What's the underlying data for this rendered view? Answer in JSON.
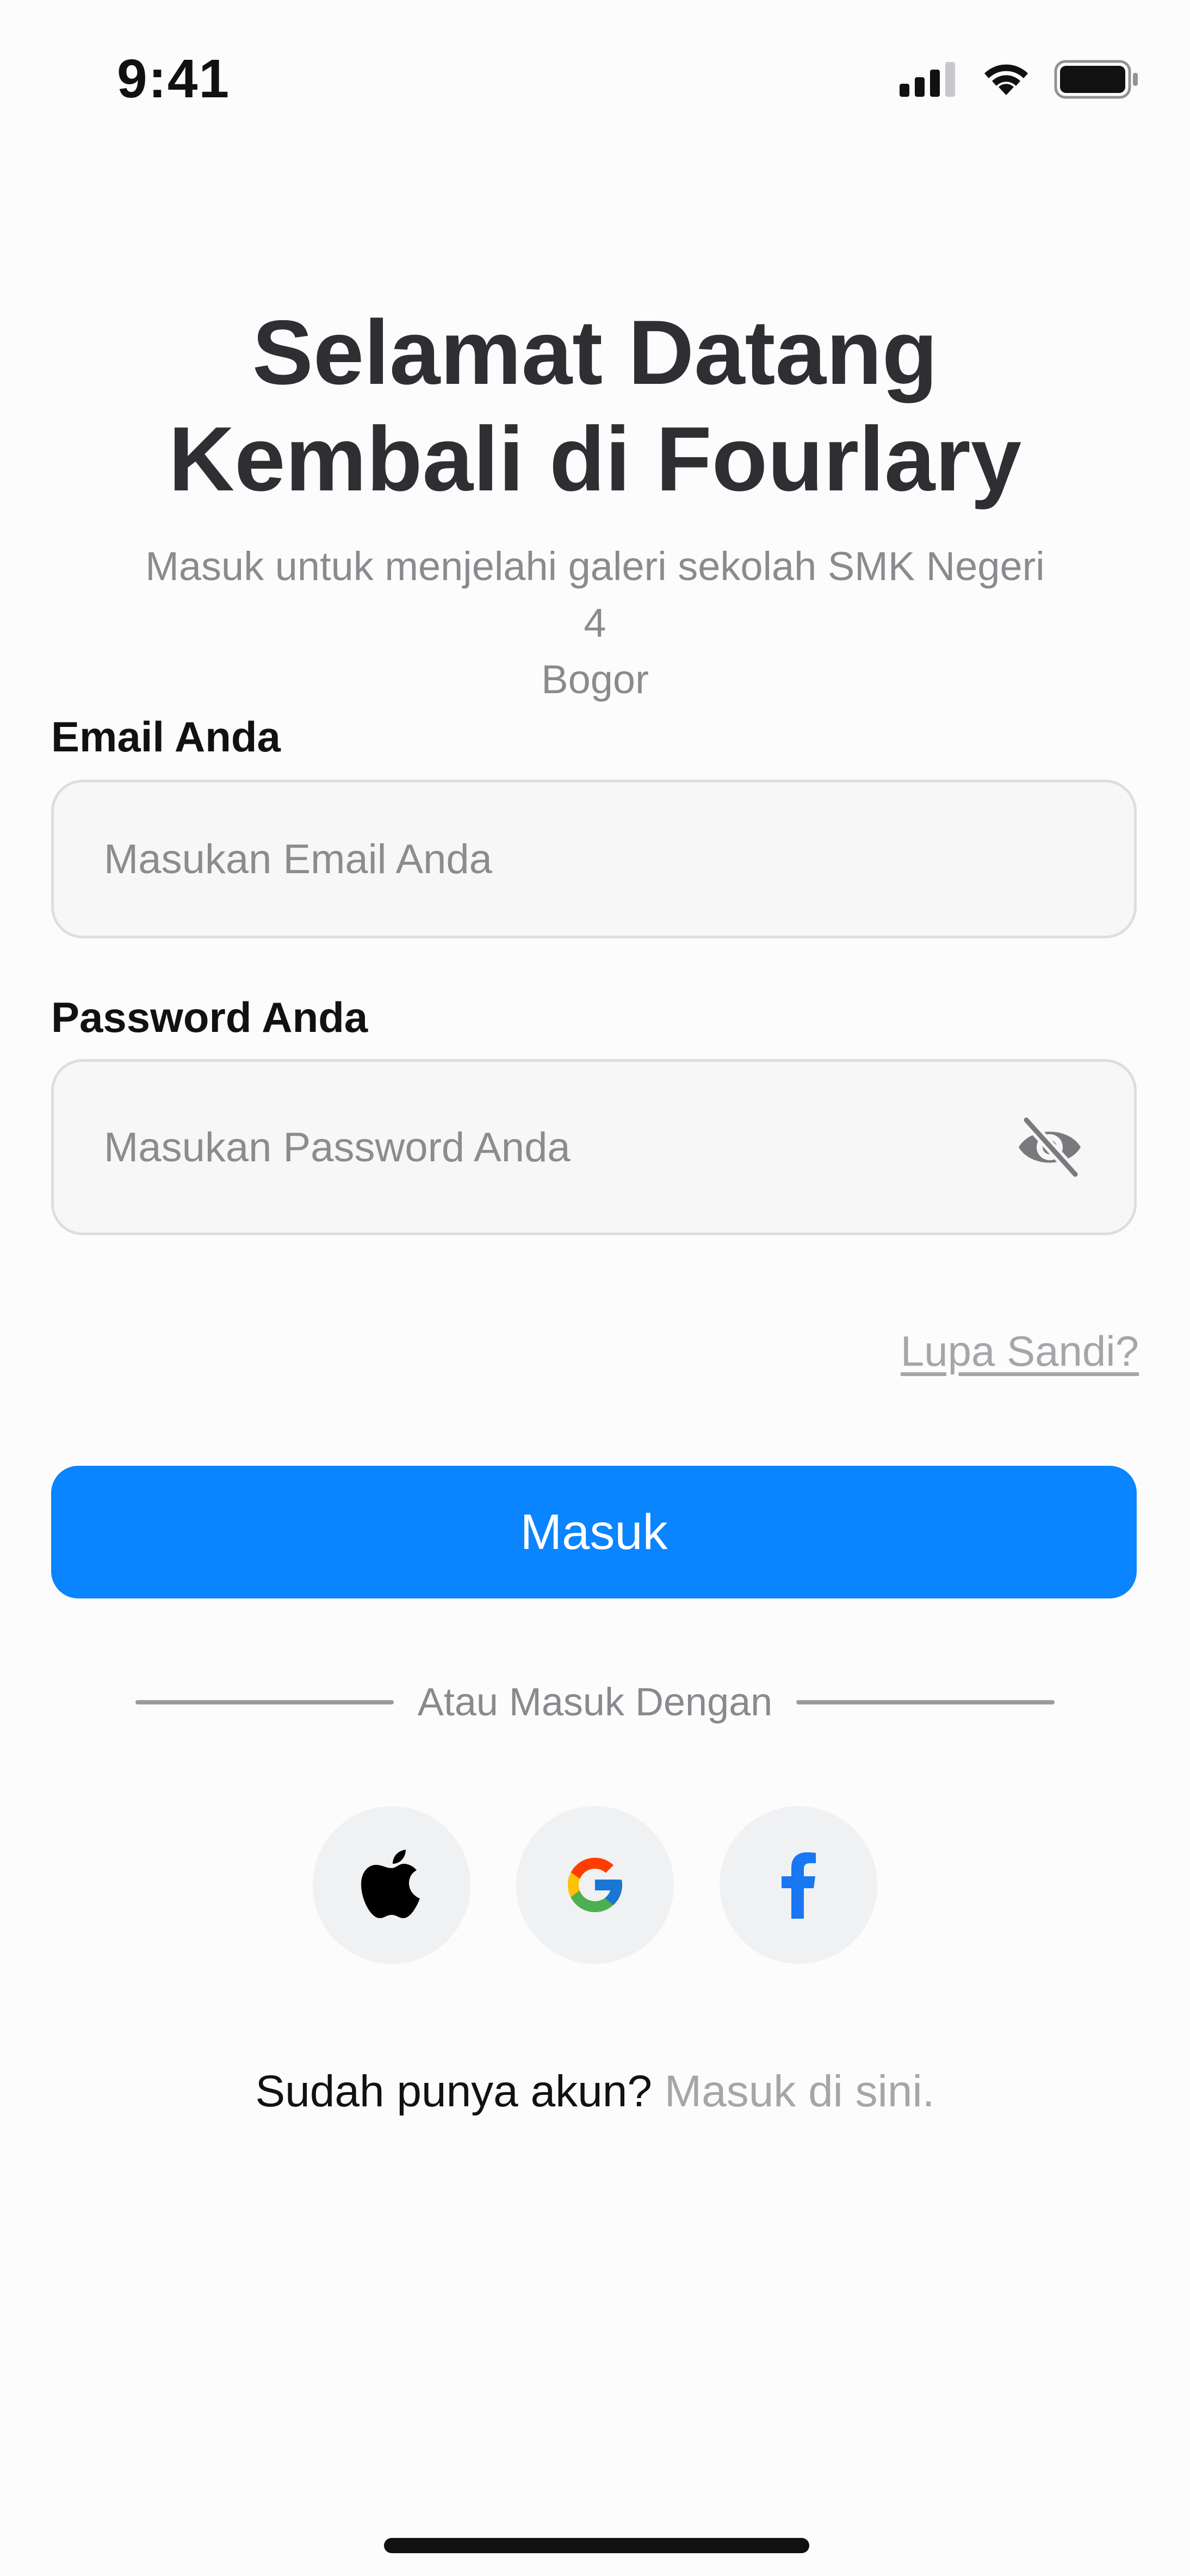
{
  "status_bar": {
    "time": "9:41",
    "signal_icon": "cellular-signal-icon",
    "wifi_icon": "wifi-icon",
    "battery_icon": "battery-icon"
  },
  "header": {
    "title_line1": "Selamat Datang",
    "title_line2": "Kembali di Fourlary",
    "subtitle_line1": "Masuk untuk menjelahi galeri sekolah SMK Negeri 4",
    "subtitle_line2": "Bogor"
  },
  "form": {
    "email_label": "Email Anda",
    "email_value": "",
    "email_placeholder": "Masukan Email Anda",
    "password_label": "Password Anda",
    "password_value": "",
    "password_placeholder": "Masukan Password Anda",
    "password_toggle_icon": "eye-off-icon",
    "forgot_label": "Lupa Sandi?",
    "submit_label": "Masuk"
  },
  "social": {
    "divider_text": "Atau Masuk Dengan",
    "providers": [
      {
        "name": "Apple",
        "icon": "apple-icon"
      },
      {
        "name": "Google",
        "icon": "google-icon"
      },
      {
        "name": "Facebook",
        "icon": "facebook-icon"
      }
    ]
  },
  "footer": {
    "prompt": "Sudah punya akun?",
    "link": "Masuk di sini."
  },
  "colors": {
    "primary": "#0a84ff",
    "title": "#2e2e33",
    "muted": "#8b8b8f",
    "link": "#a6a6aa",
    "field_bg": "#f7f7f7",
    "field_border": "#dedede",
    "social_bg": "#f0f1f3"
  }
}
